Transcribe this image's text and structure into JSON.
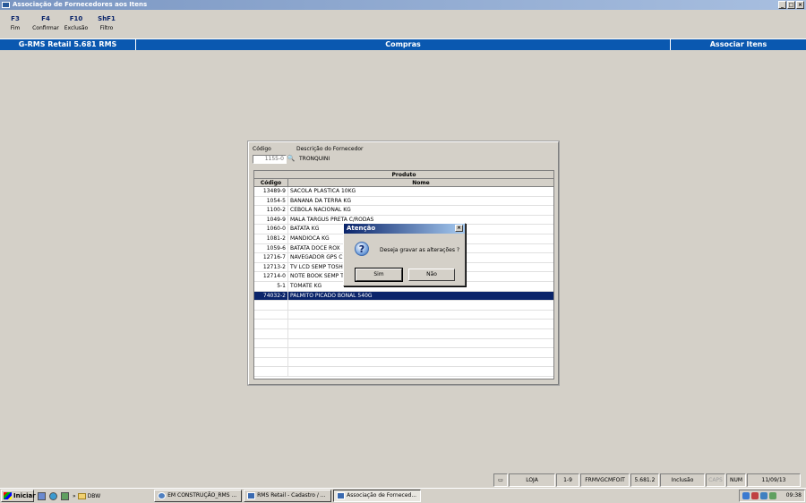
{
  "window": {
    "title": "Associação de Fornecedores aos Itens"
  },
  "fkeys": [
    {
      "key": "F3",
      "label": "Fim"
    },
    {
      "key": "F4",
      "label": "Confirmar"
    },
    {
      "key": "F10",
      "label": "Exclusão"
    },
    {
      "key": "ShF1",
      "label": "Filtro"
    }
  ],
  "infobar": {
    "app": "G-RMS Retail 5.681 RMS",
    "module": "Compras",
    "screen": "Associar Itens"
  },
  "form": {
    "codigo_label": "Código",
    "descricao_label": "Descrição do Fornecedor",
    "codigo_value": "1155-0",
    "descricao_value": "TRONQUINI"
  },
  "grid": {
    "group_header": "Produto",
    "col_codigo": "Código",
    "col_nome": "Nome",
    "rows": [
      {
        "codigo": "13489-9",
        "nome": "SACOLA PLASTICA 10KG"
      },
      {
        "codigo": "1054-5",
        "nome": "BANANA DA TERRA KG"
      },
      {
        "codigo": "1100-2",
        "nome": "CEBOLA NACIONAL KG"
      },
      {
        "codigo": "1049-9",
        "nome": "MALA TARGUS PRETA C/RODAS"
      },
      {
        "codigo": "1060-0",
        "nome": "BATATA KG"
      },
      {
        "codigo": "1081-2",
        "nome": "MANDIOCA KG"
      },
      {
        "codigo": "1059-6",
        "nome": "BATATA DOCE ROX"
      },
      {
        "codigo": "12716-7",
        "nome": "NAVEGADOR GPS C"
      },
      {
        "codigo": "12713-2",
        "nome": "TV LCD SEMP TOSHI"
      },
      {
        "codigo": "12714-0",
        "nome": "NOTE BOOK SEMP T"
      },
      {
        "codigo": "5-1",
        "nome": "TOMATE KG"
      },
      {
        "codigo": "74032-2",
        "nome": "PALMITO PICADO BONAL 540G"
      }
    ]
  },
  "dialog": {
    "title": "Atenção",
    "message": "Deseja gravar as alterações ?",
    "yes": "Sim",
    "no": "Não"
  },
  "statusbar": {
    "loja": "LOJA",
    "range": "1-9",
    "form": "FRMVGCMFOIT",
    "version": "5.681.2",
    "mode": "Inclusão",
    "caps": "CAPS",
    "num": "NUM",
    "date": "11/09/13"
  },
  "taskbar": {
    "start": "Iniciar",
    "folder": "DBW",
    "tasks": [
      "EM CONSTRUÇÃO_RMS ...",
      "RMS Retail - Cadastro / ...",
      "Associação de Forneced..."
    ],
    "clock": "09:38"
  }
}
